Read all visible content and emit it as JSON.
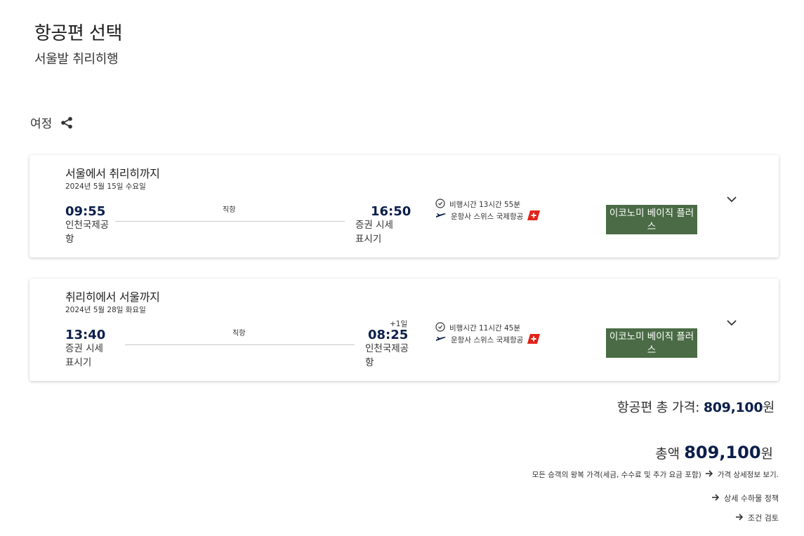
{
  "page": {
    "title": "항공편 선택",
    "subtitle": "서울발 취리히행"
  },
  "itinerary": {
    "label": "여정",
    "share_icon": "share-icon"
  },
  "flights": [
    {
      "route_title": "서울에서 취리히까지",
      "date": "2024년 5월 15일 수요일",
      "departure_time": "09:55",
      "departure_place": "인천국제공항",
      "stops": "직항",
      "arrival_time": "16:50",
      "arrival_place": "증권 시세 표시기",
      "day_offset": "",
      "duration": "비행시간 13시간 55분",
      "operator": "운항사 스위스 국제항공",
      "cabin": "이코노미 베이직 플러스"
    },
    {
      "route_title": "취리히에서 서울까지",
      "date": "2024년 5월 28일 화요일",
      "departure_time": "13:40",
      "departure_place": "증권 시세 표시기",
      "stops": "직항",
      "arrival_time": "08:25",
      "arrival_place": "인천국제공항",
      "day_offset": "+1일",
      "duration": "비행시간 11시간 45분",
      "operator": "운항사 스위스 국제항공",
      "cabin": "이코노미 베이직 플러스"
    }
  ],
  "pricing": {
    "flight_total_label": "항공편 총 가격:",
    "flight_total_amount": "809,100",
    "currency": "원",
    "grand_total_label": "총액",
    "grand_total_amount": "809,100",
    "note": "모든 승객의 왕복 가격(세금, 수수료 및 추가 요금 포함)",
    "details_link": "가격 상세정보 보기.",
    "policy_link": "상세 수하물 정책",
    "terms_link": "조건 검토"
  },
  "colors": {
    "cabin_button": "#4a6b45",
    "time_text": "#0b1f4b",
    "swiss_red": "#e2231a"
  }
}
